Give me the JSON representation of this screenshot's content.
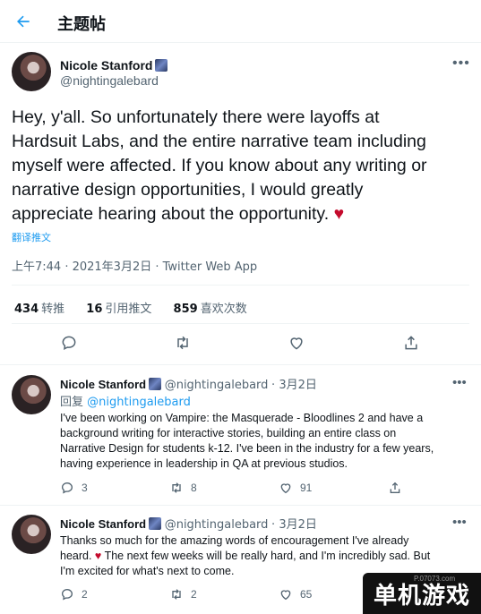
{
  "header": {
    "title": "主题帖"
  },
  "tweet": {
    "author_name": "Nicole Stanford",
    "author_handle": "@nightingalebard",
    "text_lines": [
      "Hey, y'all. So unfortunately there were layoffs at",
      "Hardsuit Labs, and the entire narrative team including",
      "myself were affected. If you know about any writing or",
      "narrative design opportunities, I would greatly",
      "appreciate hearing about the opportunity."
    ],
    "heart": "♥",
    "translate_label": "翻译推文",
    "meta": "上午7:44 · 2021年3月2日 · Twitter Web App",
    "stats": {
      "retweets_count": "434",
      "retweets_label": "转推",
      "quotes_count": "16",
      "quotes_label": "引用推文",
      "likes_count": "859",
      "likes_label": "喜欢次数"
    }
  },
  "replies": [
    {
      "name": "Nicole Stanford",
      "handle": "@nightingalebard",
      "date": "3月2日",
      "reply_to_label": "回复",
      "reply_to_handle": "@nightingalebard",
      "lines": [
        "I've been working on Vampire: the Masquerade - Bloodlines 2 and have a",
        "background writing for interactive stories, building an entire class on",
        "Narrative Design for students k-12. I've been in the industry for a few years,",
        "having experience in leadership in QA at previous studios."
      ],
      "replies": "3",
      "retweets": "8",
      "likes": "91"
    },
    {
      "name": "Nicole Stanford",
      "handle": "@nightingalebard",
      "date": "3月2日",
      "lines": [
        "Thanks so much for the amazing words of encouragement I've already",
        "heard. ♥ The next few weeks will be really hard, and I'm incredibly sad. But",
        "I'm excited for what's next to come."
      ],
      "replies": "2",
      "retweets": "2",
      "likes": "65"
    }
  ],
  "watermark": {
    "text": "单机游戏",
    "url": "P.07073.com"
  },
  "colors": {
    "accent": "#1d9bf0",
    "heart": "#c40a2c",
    "muted": "#536471"
  },
  "icons": [
    "back-arrow-icon",
    "flag-icon",
    "more-icon",
    "reply-icon",
    "retweet-icon",
    "like-icon",
    "share-icon"
  ]
}
